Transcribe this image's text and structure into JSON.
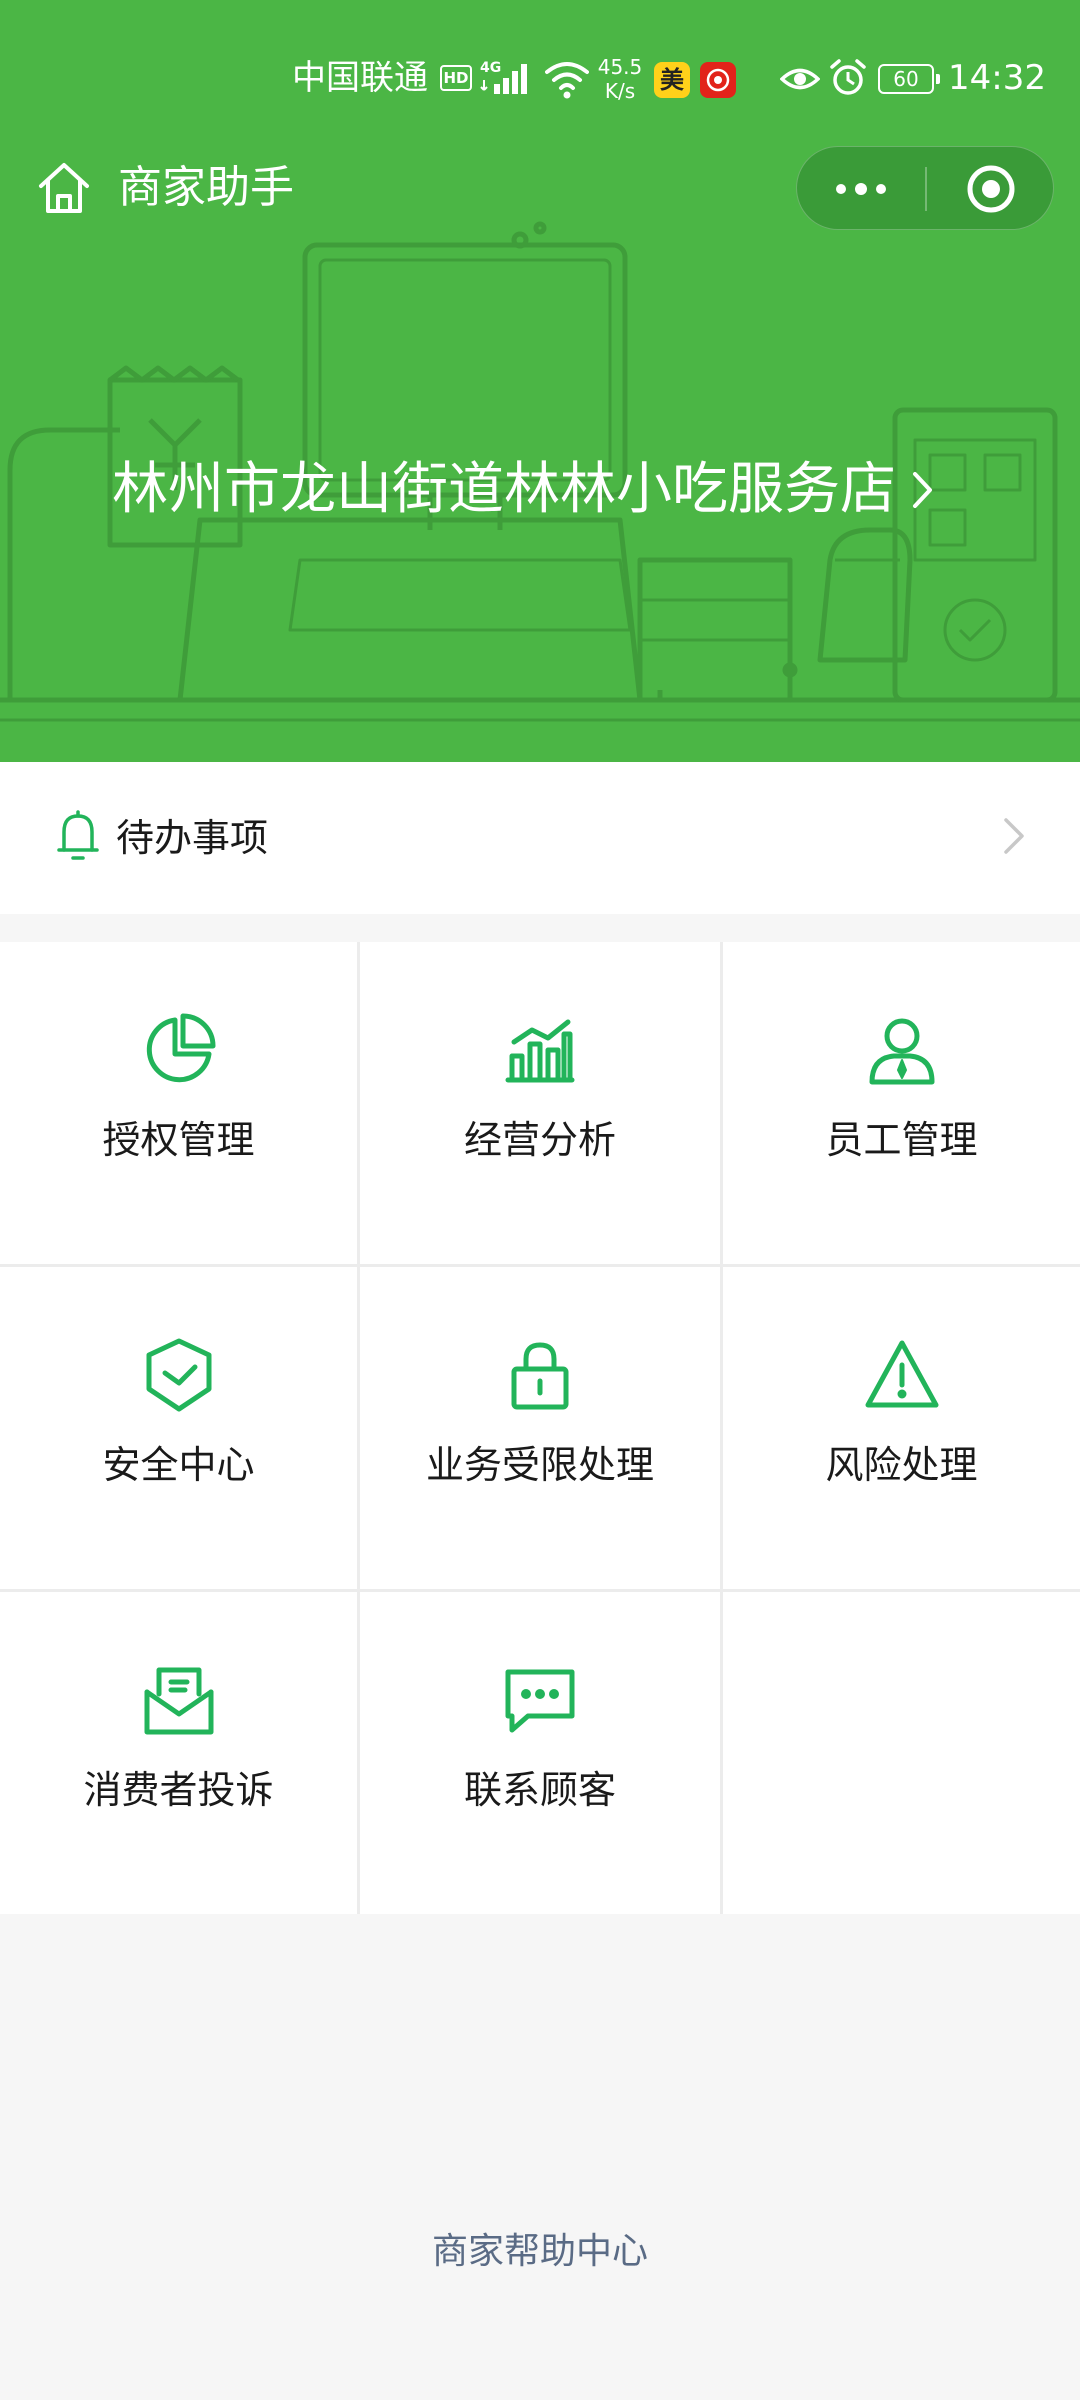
{
  "status_bar": {
    "carrier": "中国联通",
    "hd": "HD",
    "network": "4G",
    "speed_value": "45.5",
    "speed_unit": "K/s",
    "app1": "美",
    "battery": "60",
    "time": "14:32"
  },
  "nav": {
    "title": "商家助手"
  },
  "store": {
    "name": "林州市龙山街道林林小吃服务店"
  },
  "todo": {
    "label": "待办事项"
  },
  "grid": {
    "items": [
      {
        "label": "授权管理",
        "icon": "pie-chart-icon"
      },
      {
        "label": "经营分析",
        "icon": "bar-chart-icon"
      },
      {
        "label": "员工管理",
        "icon": "user-icon"
      },
      {
        "label": "安全中心",
        "icon": "shield-icon"
      },
      {
        "label": "业务受限处理",
        "icon": "lock-icon"
      },
      {
        "label": "风险处理",
        "icon": "warning-icon"
      },
      {
        "label": "消费者投诉",
        "icon": "mail-icon"
      },
      {
        "label": "联系顾客",
        "icon": "chat-icon"
      }
    ]
  },
  "footer": {
    "help_center": "商家帮助中心"
  },
  "colors": {
    "header_green": "#4bb645",
    "icon_green": "#22b45a",
    "page_background": "#f6f6f6",
    "link_gray_blue": "#5a6b85"
  }
}
